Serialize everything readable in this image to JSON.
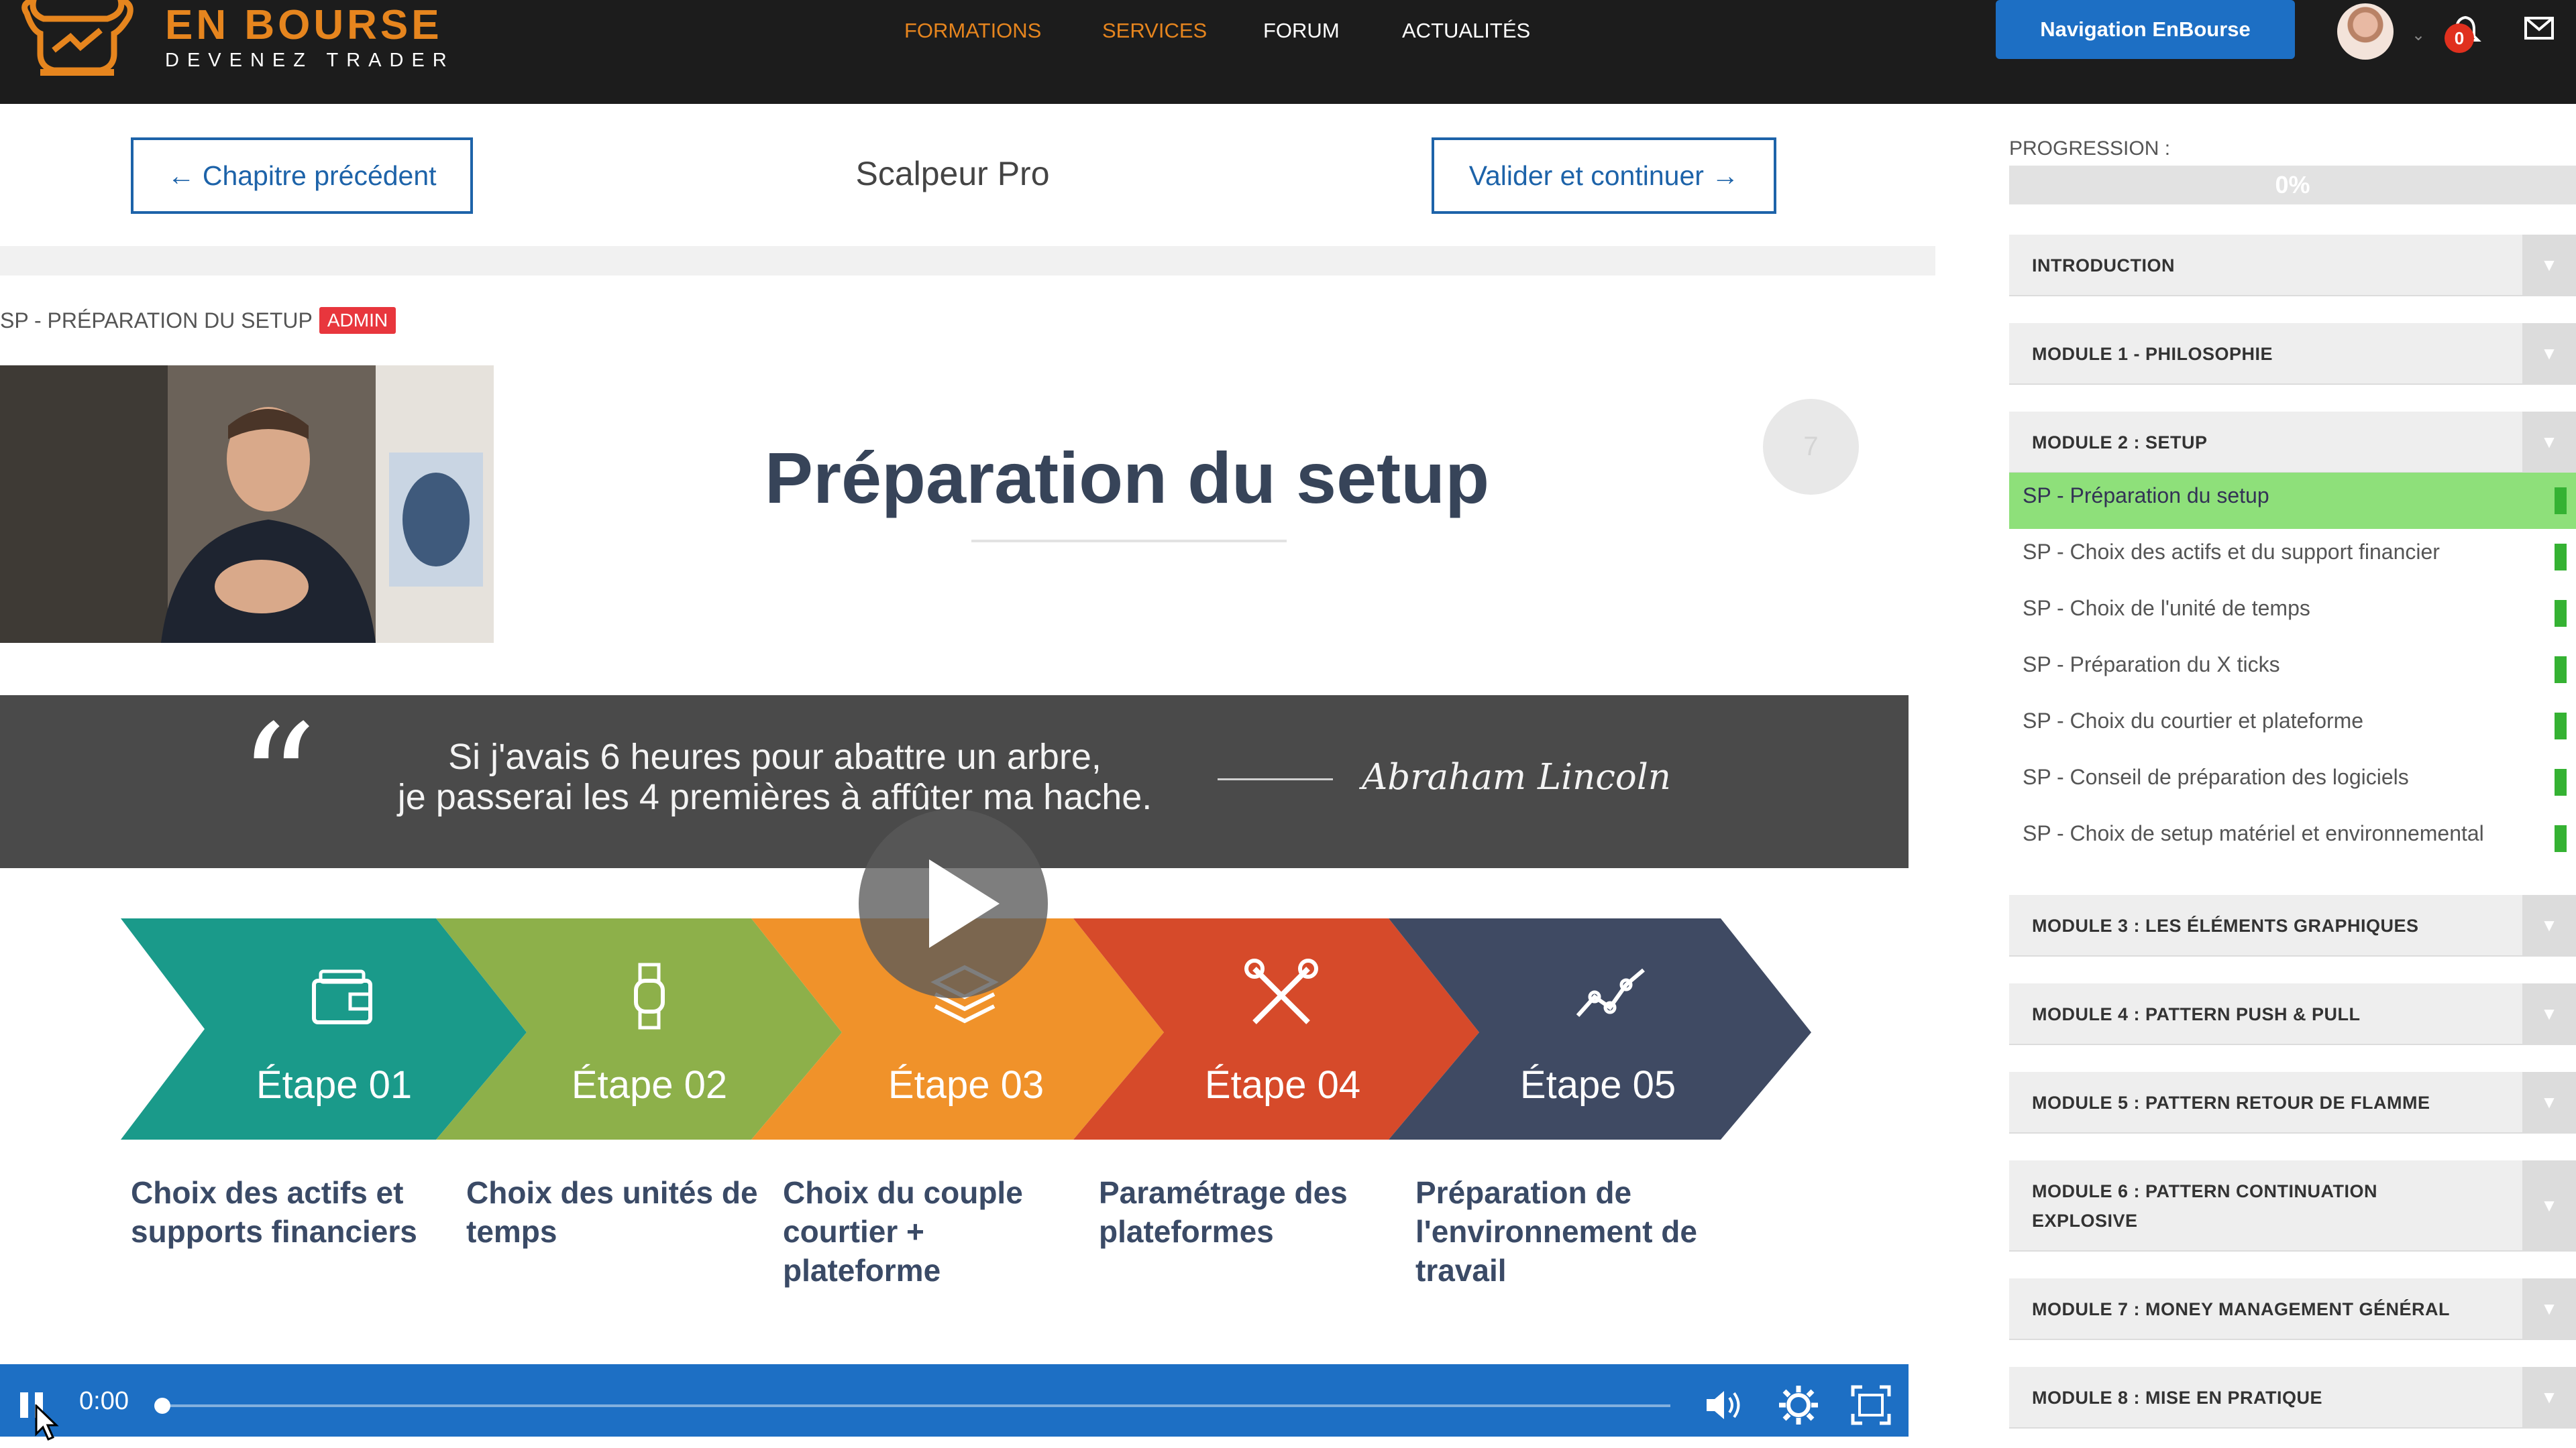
{
  "header": {
    "brand_name": "EN BOURSE",
    "brand_tagline": "DEVENEZ TRADER",
    "nav": [
      {
        "label": "FORMATIONS",
        "color": "#e6851e"
      },
      {
        "label": "SERVICES",
        "color": "#e6851e"
      },
      {
        "label": "FORUM",
        "color": "#ffffff"
      },
      {
        "label": "ACTUALITÉS",
        "color": "#ffffff"
      }
    ],
    "nav_button_label": "Navigation EnBourse",
    "notification_count": "0",
    "icons": [
      "bull-logo-icon",
      "avatar",
      "bell-icon",
      "mail-icon"
    ]
  },
  "chapter_nav": {
    "prev_label": "← Chapitre précédent",
    "course_title": "Scalpeur Pro",
    "next_label": "Valider et continuer →"
  },
  "lesson": {
    "tag_label": "SP - PRÉPARATION DU SETUP",
    "admin_badge": "ADMIN"
  },
  "video": {
    "slide_title": "Préparation du setup",
    "slide_number": "7",
    "quote_line1": "Si j'avais 6 heures pour abattre un arbre,",
    "quote_line2": "je passerai les 4 premières à affûter ma hache.",
    "quote_author": "Abraham Lincoln",
    "steps": [
      {
        "label": "Étape 01",
        "desc": "Choix des actifs et supports financiers",
        "color": "#1a9a8a",
        "icon": "wallet-icon"
      },
      {
        "label": "Étape 02",
        "desc": "Choix des unités de temps",
        "color": "#8db04a",
        "icon": "watch-icon"
      },
      {
        "label": "Étape 03",
        "desc": "Choix du couple courtier + plateforme",
        "color": "#f0922a",
        "icon": "layers-icon"
      },
      {
        "label": "Étape 04",
        "desc": "Paramétrage des plateformes",
        "color": "#d64a2a",
        "icon": "tools-icon"
      },
      {
        "label": "Étape 05",
        "desc": "Préparation de l'environnement de travail",
        "color": "#3f4a63",
        "icon": "chart-line-icon"
      }
    ],
    "player": {
      "time": "0:00",
      "accent": "#1d6fc4"
    }
  },
  "sidebar": {
    "progress_label": "PROGRESSION :",
    "progress_value": "0%",
    "modules": [
      {
        "title": "INTRODUCTION"
      },
      {
        "title": "MODULE 1 - PHILOSOPHIE"
      },
      {
        "title": "MODULE 2 : SETUP"
      },
      {
        "title": "MODULE 3 : LES ÉLÉMENTS GRAPHIQUES"
      },
      {
        "title": "MODULE 4 : PATTERN PUSH & PULL"
      },
      {
        "title": "MODULE 5 : PATTERN RETOUR DE FLAMME"
      },
      {
        "title": "MODULE 6 : PATTERN CONTINUATION",
        "title_line2": "EXPLOSIVE"
      },
      {
        "title": "MODULE 7 : MONEY MANAGEMENT GÉNÉRAL"
      },
      {
        "title": "MODULE 8 : MISE EN PRATIQUE"
      }
    ],
    "lessons": [
      {
        "label": "SP - Préparation du setup",
        "active": true
      },
      {
        "label": "SP - Choix des actifs et du support financier",
        "active": false
      },
      {
        "label": "SP - Choix de l'unité de temps",
        "active": false
      },
      {
        "label": "SP - Préparation du X ticks",
        "active": false
      },
      {
        "label": "SP - Choix du courtier et plateforme",
        "active": false
      },
      {
        "label": "SP - Conseil de préparation des logiciels",
        "active": false
      },
      {
        "label": "SP - Choix de setup matériel et environnemental",
        "active": false
      }
    ]
  }
}
